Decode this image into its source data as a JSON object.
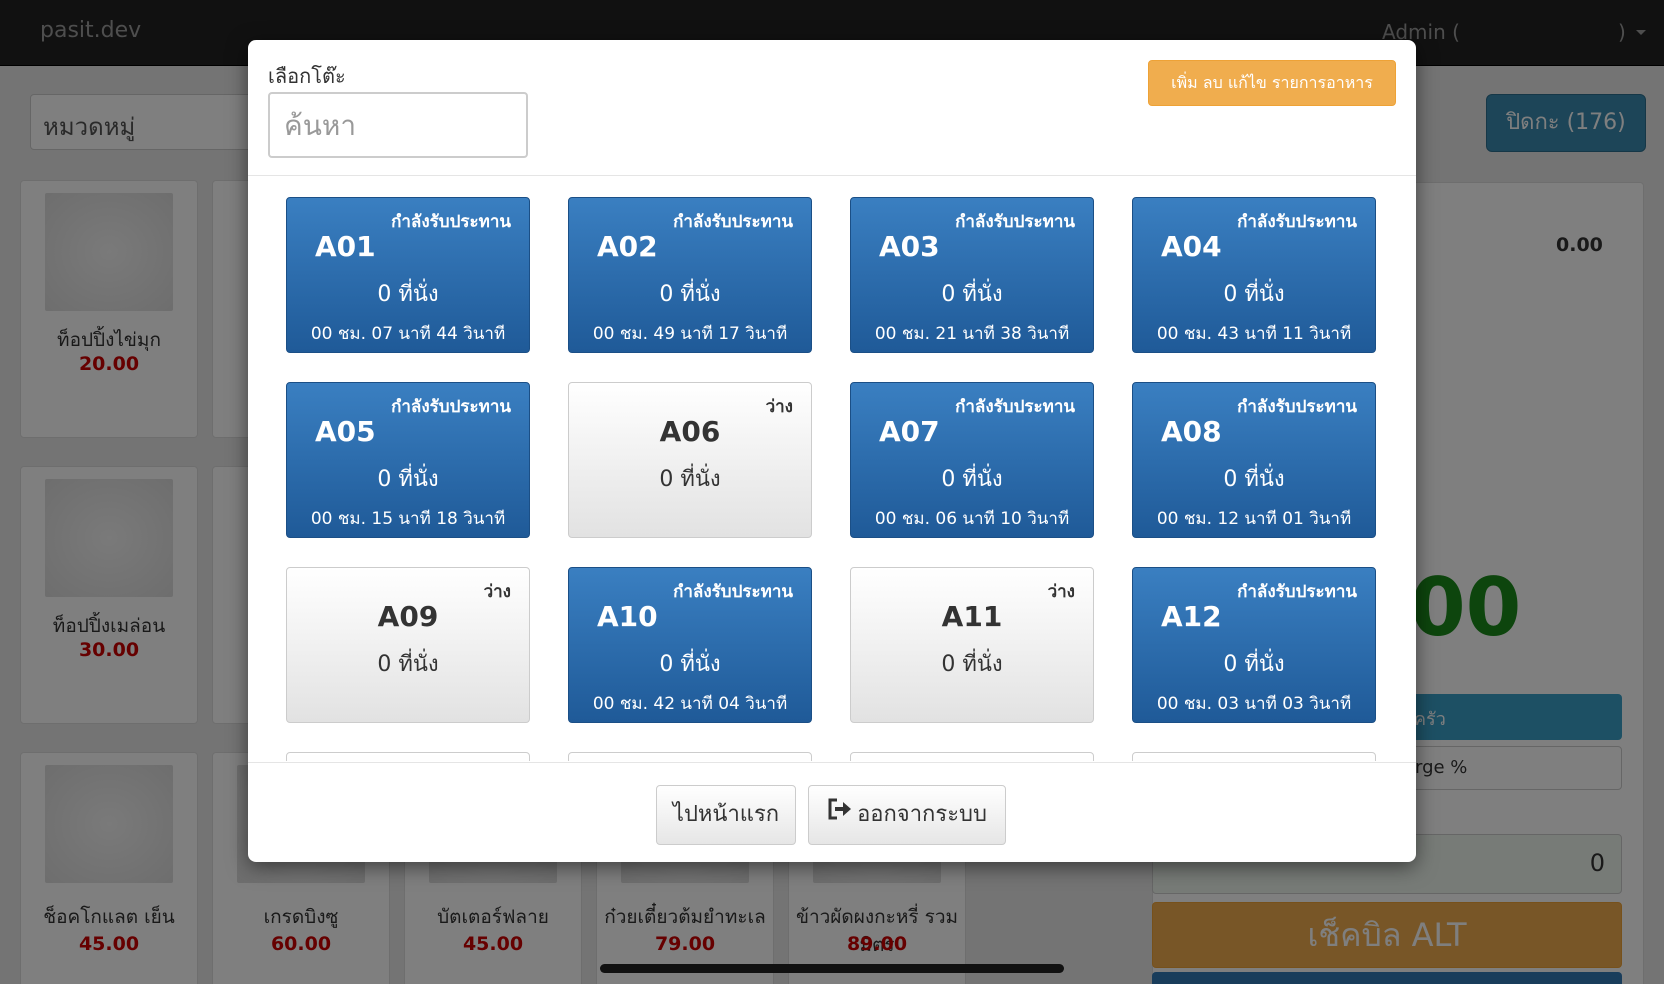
{
  "navbar": {
    "brand": "pasit.dev",
    "user": "Admin (",
    "user_close": ")"
  },
  "category": {
    "label": "หมวดหมู่"
  },
  "close_shift": {
    "label": "ปิดกะ (176)"
  },
  "products": [
    {
      "name": "ท็อปปิ้งไข่มุก",
      "price": "20.00"
    },
    {
      "name": "ท็อปปิ้งเมล่อน",
      "price": "30.00"
    },
    {
      "name": "ช็อคโกแลต เย็น",
      "price": "45.00"
    },
    {
      "name": "เกรดบิงซู",
      "price": "60.00"
    },
    {
      "name": "บัตเตอร์ฟลาย",
      "price": "45.00"
    },
    {
      "name": "ก๋วยเตี๋ยวต้มยำทะเล",
      "price": "79.00"
    },
    {
      "name": "ข้าวผัดผงกะหรี่ รวมมิตร",
      "price": "89.00"
    }
  ],
  "order_panel": {
    "subtotal": "0.00",
    "total_fragment": "00",
    "kitchen_fragment": "ครัว",
    "charge_fragment": "rge %",
    "amount_value": "0",
    "check_bill": "เช็คบิล ALT"
  },
  "modal": {
    "title": "เลือกโต๊ะ",
    "search_placeholder": "ค้นหา",
    "manage_menu_label": "เพิ่ม ลบ แก้ไข รายการอาหาร",
    "tables": [
      {
        "code": "A01",
        "status": "กำลังรับประทาน",
        "seats": "0 ที่นั่ง",
        "time": "00 ชม. 07 นาที 44 วินาที",
        "busy": true
      },
      {
        "code": "A02",
        "status": "กำลังรับประทาน",
        "seats": "0 ที่นั่ง",
        "time": "00 ชม. 49 นาที 17 วินาที",
        "busy": true
      },
      {
        "code": "A03",
        "status": "กำลังรับประทาน",
        "seats": "0 ที่นั่ง",
        "time": "00 ชม. 21 นาที 38 วินาที",
        "busy": true
      },
      {
        "code": "A04",
        "status": "กำลังรับประทาน",
        "seats": "0 ที่นั่ง",
        "time": "00 ชม. 43 นาที 11 วินาที",
        "busy": true
      },
      {
        "code": "A05",
        "status": "กำลังรับประทาน",
        "seats": "0 ที่นั่ง",
        "time": "00 ชม. 15 นาที 18 วินาที",
        "busy": true
      },
      {
        "code": "A06",
        "status": "ว่าง",
        "seats": "0 ที่นั่ง",
        "time": "",
        "busy": false
      },
      {
        "code": "A07",
        "status": "กำลังรับประทาน",
        "seats": "0 ที่นั่ง",
        "time": "00 ชม. 06 นาที 10 วินาที",
        "busy": true
      },
      {
        "code": "A08",
        "status": "กำลังรับประทาน",
        "seats": "0 ที่นั่ง",
        "time": "00 ชม. 12 นาที 01 วินาที",
        "busy": true
      },
      {
        "code": "A09",
        "status": "ว่าง",
        "seats": "0 ที่นั่ง",
        "time": "",
        "busy": false
      },
      {
        "code": "A10",
        "status": "กำลังรับประทาน",
        "seats": "0 ที่นั่ง",
        "time": "00 ชม. 42 นาที 04 วินาที",
        "busy": true
      },
      {
        "code": "A11",
        "status": "ว่าง",
        "seats": "0 ที่นั่ง",
        "time": "",
        "busy": false
      },
      {
        "code": "A12",
        "status": "กำลังรับประทาน",
        "seats": "0 ที่นั่ง",
        "time": "00 ชม. 03 นาที 03 วินาที",
        "busy": true
      }
    ],
    "home_label": "ไปหน้าแรก",
    "logout_label": "ออกจากระบบ"
  },
  "colors": {
    "busy_tile": "#2a6aad",
    "free_tile": "#f2f2f2",
    "warning": "#f0ad4e",
    "price": "#cc0000",
    "total": "#1a8a1a"
  }
}
